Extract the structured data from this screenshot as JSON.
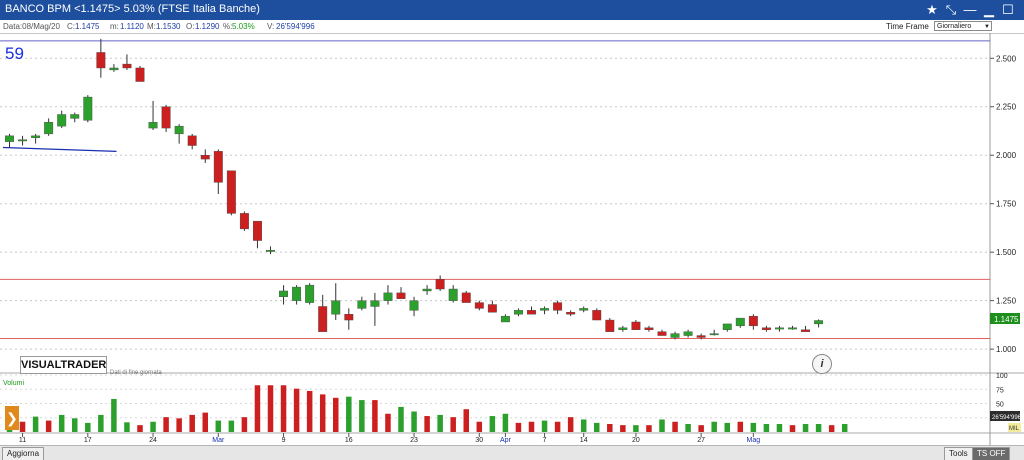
{
  "window": {
    "title": "BANCO BPM  <1.1475>  5.03%   (FTSE Italia Banche)"
  },
  "infobar": {
    "data": "Data:08/Mag/20",
    "close_label": "C:",
    "close_value": "1.1475",
    "min_label": "m:",
    "min_value": "1.1120",
    "max_label": "M:",
    "max_value": "1.1530",
    "open_label": "O:",
    "open_value": "1.1290",
    "pct_label": "%:",
    "pct_value": "5.03%",
    "vol_label": "V:",
    "vol_value": "26'594'996",
    "timeframe_label": "Time Frame",
    "timeframe_value": "Giornaliero"
  },
  "icons": {
    "star": "star-icon",
    "pin": "pin-icon",
    "dash": "dash-icon",
    "minimize": "minimize-icon",
    "maximize": "maximize-icon",
    "close": "close-icon"
  },
  "overlay": {
    "count": "59",
    "logo": "VISUALTRADER",
    "subtitle": "Dati di fine giornata",
    "info_icon": "i",
    "volume_label": "Volumi",
    "last_price_badge": "1.1475",
    "last_volume_badge": "26'594'996",
    "vol_unit": "MIL"
  },
  "bottombar": {
    "refresh": "Aggiorna",
    "tools": "Tools",
    "ts": "TS OFF"
  },
  "colors": {
    "up": "#2ca02c",
    "down": "#cc1f1f",
    "hline_red": "#e06060",
    "hline_blue": "#6464c8",
    "trend": "#1a2fb0",
    "badge": "#1c8f1c",
    "accent_blue": "#1e4f9e"
  },
  "chart_data": {
    "type": "candlestick",
    "price_axis": {
      "min": 0.98,
      "max": 2.62,
      "ticks": [
        "2.500",
        "2.250",
        "2.000",
        "1.750",
        "1.500",
        "1.250",
        "1.000"
      ]
    },
    "volume_axis": {
      "max": 100,
      "ticks": [
        "100",
        "75",
        "50",
        "25"
      ]
    },
    "x_ticks": [
      {
        "label": "11",
        "at": 1
      },
      {
        "label": "17",
        "at": 6
      },
      {
        "label": "24",
        "at": 11
      },
      {
        "label": "Mar",
        "at": 16
      },
      {
        "label": "9",
        "at": 21
      },
      {
        "label": "16",
        "at": 26
      },
      {
        "label": "23",
        "at": 31
      },
      {
        "label": "30",
        "at": 36
      },
      {
        "label": "Apr",
        "at": 38
      },
      {
        "label": "7",
        "at": 41
      },
      {
        "label": "14",
        "at": 44
      },
      {
        "label": "20",
        "at": 48
      },
      {
        "label": "27",
        "at": 53
      },
      {
        "label": "Mag",
        "at": 57
      }
    ],
    "hlines": [
      {
        "value": 2.59,
        "color": "blue"
      },
      {
        "value": 1.36,
        "color": "red"
      },
      {
        "value": 1.055,
        "color": "red"
      }
    ],
    "trendline": {
      "from": {
        "index": -0.5,
        "value": 2.04
      },
      "to": {
        "index": 8.2,
        "value": 2.02
      }
    },
    "candles": [
      {
        "o": 2.07,
        "h": 2.11,
        "l": 2.04,
        "c": 2.1
      },
      {
        "o": 2.08,
        "h": 2.1,
        "l": 2.05,
        "c": 2.08
      },
      {
        "o": 2.09,
        "h": 2.11,
        "l": 2.06,
        "c": 2.1
      },
      {
        "o": 2.11,
        "h": 2.19,
        "l": 2.1,
        "c": 2.17
      },
      {
        "o": 2.15,
        "h": 2.23,
        "l": 2.14,
        "c": 2.21
      },
      {
        "o": 2.19,
        "h": 2.22,
        "l": 2.17,
        "c": 2.21
      },
      {
        "o": 2.18,
        "h": 2.31,
        "l": 2.17,
        "c": 2.3
      },
      {
        "o": 2.53,
        "h": 2.6,
        "l": 2.4,
        "c": 2.45
      },
      {
        "o": 2.44,
        "h": 2.47,
        "l": 2.43,
        "c": 2.45
      },
      {
        "o": 2.47,
        "h": 2.52,
        "l": 2.44,
        "c": 2.45
      },
      {
        "o": 2.45,
        "h": 2.46,
        "l": 2.38,
        "c": 2.38
      },
      {
        "o": 2.14,
        "h": 2.28,
        "l": 2.13,
        "c": 2.17
      },
      {
        "o": 2.25,
        "h": 2.26,
        "l": 2.12,
        "c": 2.14
      },
      {
        "o": 2.11,
        "h": 2.16,
        "l": 2.06,
        "c": 2.15
      },
      {
        "o": 2.1,
        "h": 2.11,
        "l": 2.03,
        "c": 2.05
      },
      {
        "o": 2.0,
        "h": 2.03,
        "l": 1.96,
        "c": 1.98
      },
      {
        "o": 2.02,
        "h": 2.03,
        "l": 1.8,
        "c": 1.86
      },
      {
        "o": 1.92,
        "h": 1.92,
        "l": 1.69,
        "c": 1.7
      },
      {
        "o": 1.7,
        "h": 1.71,
        "l": 1.61,
        "c": 1.62
      },
      {
        "o": 1.66,
        "h": 1.66,
        "l": 1.52,
        "c": 1.56
      },
      {
        "o": 1.51,
        "h": 1.53,
        "l": 1.49,
        "c": 1.51
      },
      {
        "o": 1.27,
        "h": 1.33,
        "l": 1.23,
        "c": 1.3
      },
      {
        "o": 1.25,
        "h": 1.33,
        "l": 1.23,
        "c": 1.32
      },
      {
        "o": 1.24,
        "h": 1.34,
        "l": 1.23,
        "c": 1.33
      },
      {
        "o": 1.22,
        "h": 1.28,
        "l": 1.09,
        "c": 1.09
      },
      {
        "o": 1.18,
        "h": 1.34,
        "l": 1.15,
        "c": 1.25
      },
      {
        "o": 1.18,
        "h": 1.21,
        "l": 1.1,
        "c": 1.15
      },
      {
        "o": 1.21,
        "h": 1.27,
        "l": 1.2,
        "c": 1.25
      },
      {
        "o": 1.22,
        "h": 1.29,
        "l": 1.12,
        "c": 1.25
      },
      {
        "o": 1.25,
        "h": 1.33,
        "l": 1.23,
        "c": 1.29
      },
      {
        "o": 1.29,
        "h": 1.32,
        "l": 1.26,
        "c": 1.26
      },
      {
        "o": 1.2,
        "h": 1.27,
        "l": 1.17,
        "c": 1.25
      },
      {
        "o": 1.3,
        "h": 1.33,
        "l": 1.28,
        "c": 1.31
      },
      {
        "o": 1.36,
        "h": 1.38,
        "l": 1.3,
        "c": 1.31
      },
      {
        "o": 1.25,
        "h": 1.33,
        "l": 1.24,
        "c": 1.31
      },
      {
        "o": 1.29,
        "h": 1.3,
        "l": 1.24,
        "c": 1.24
      },
      {
        "o": 1.24,
        "h": 1.25,
        "l": 1.2,
        "c": 1.21
      },
      {
        "o": 1.23,
        "h": 1.25,
        "l": 1.19,
        "c": 1.19
      },
      {
        "o": 1.14,
        "h": 1.18,
        "l": 1.14,
        "c": 1.17
      },
      {
        "o": 1.18,
        "h": 1.21,
        "l": 1.17,
        "c": 1.2
      },
      {
        "o": 1.2,
        "h": 1.22,
        "l": 1.18,
        "c": 1.18
      },
      {
        "o": 1.2,
        "h": 1.22,
        "l": 1.18,
        "c": 1.21
      },
      {
        "o": 1.24,
        "h": 1.25,
        "l": 1.18,
        "c": 1.2
      },
      {
        "o": 1.19,
        "h": 1.2,
        "l": 1.17,
        "c": 1.18
      },
      {
        "o": 1.2,
        "h": 1.22,
        "l": 1.19,
        "c": 1.21
      },
      {
        "o": 1.2,
        "h": 1.21,
        "l": 1.15,
        "c": 1.15
      },
      {
        "o": 1.15,
        "h": 1.16,
        "l": 1.09,
        "c": 1.09
      },
      {
        "o": 1.1,
        "h": 1.12,
        "l": 1.09,
        "c": 1.11
      },
      {
        "o": 1.14,
        "h": 1.15,
        "l": 1.1,
        "c": 1.1
      },
      {
        "o": 1.11,
        "h": 1.12,
        "l": 1.09,
        "c": 1.1
      },
      {
        "o": 1.09,
        "h": 1.1,
        "l": 1.07,
        "c": 1.07
      },
      {
        "o": 1.06,
        "h": 1.09,
        "l": 1.05,
        "c": 1.08
      },
      {
        "o": 1.07,
        "h": 1.1,
        "l": 1.06,
        "c": 1.09
      },
      {
        "o": 1.07,
        "h": 1.08,
        "l": 1.05,
        "c": 1.06
      },
      {
        "o": 1.08,
        "h": 1.1,
        "l": 1.07,
        "c": 1.08
      },
      {
        "o": 1.1,
        "h": 1.13,
        "l": 1.09,
        "c": 1.13
      },
      {
        "o": 1.12,
        "h": 1.16,
        "l": 1.11,
        "c": 1.16
      },
      {
        "o": 1.17,
        "h": 1.18,
        "l": 1.1,
        "c": 1.12
      },
      {
        "o": 1.11,
        "h": 1.12,
        "l": 1.09,
        "c": 1.1
      },
      {
        "o": 1.11,
        "h": 1.12,
        "l": 1.09,
        "c": 1.11
      },
      {
        "o": 1.11,
        "h": 1.12,
        "l": 1.1,
        "c": 1.11
      },
      {
        "o": 1.1,
        "h": 1.12,
        "l": 1.09,
        "c": 1.09
      },
      {
        "o": 1.13,
        "h": 1.153,
        "l": 1.112,
        "c": 1.1475
      }
    ],
    "volumes": [
      38,
      18,
      27,
      20,
      30,
      24,
      16,
      30,
      58,
      17,
      12,
      18,
      26,
      24,
      30,
      34,
      20,
      20,
      26,
      82,
      82,
      82,
      76,
      72,
      66,
      60,
      62,
      56,
      56,
      32,
      44,
      36,
      28,
      30,
      26,
      40,
      18,
      28,
      32,
      16,
      18,
      20,
      18,
      26,
      22,
      16,
      14,
      12,
      12,
      12,
      22,
      18,
      14,
      12,
      18,
      16,
      18,
      16,
      14,
      14,
      12,
      14,
      14,
      12,
      14
    ],
    "volume_colors": [
      "up",
      "down",
      "up",
      "down",
      "up",
      "up",
      "up",
      "up",
      "up",
      "up",
      "down",
      "up",
      "down",
      "down",
      "down",
      "down",
      "up",
      "up",
      "down",
      "down",
      "down",
      "down",
      "down",
      "down",
      "down",
      "down",
      "up",
      "up",
      "down",
      "down",
      "up",
      "up",
      "down",
      "up",
      "down",
      "down",
      "down",
      "up",
      "up",
      "down",
      "down",
      "up",
      "down",
      "down",
      "up",
      "up",
      "down",
      "down",
      "up",
      "down",
      "up",
      "down",
      "up",
      "down",
      "up",
      "up",
      "down",
      "up",
      "up",
      "up",
      "down",
      "up",
      "up",
      "down",
      "up"
    ]
  }
}
